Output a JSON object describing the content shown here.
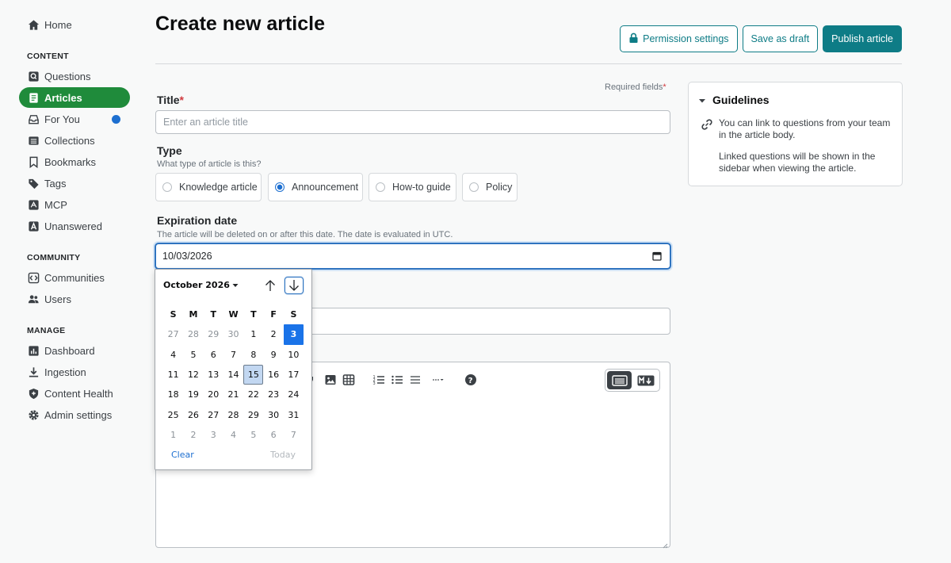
{
  "sidebar": {
    "home": "Home",
    "sections": {
      "content": "CONTENT",
      "community": "COMMUNITY",
      "manage": "MANAGE"
    },
    "content_items": [
      {
        "label": "Questions",
        "icon": "questions-icon"
      },
      {
        "label": "Articles",
        "icon": "articles-icon",
        "active": true
      },
      {
        "label": "For You",
        "icon": "inbox-icon",
        "badge": true
      },
      {
        "label": "Collections",
        "icon": "collections-icon"
      },
      {
        "label": "Bookmarks",
        "icon": "bookmark-icon"
      },
      {
        "label": "Tags",
        "icon": "tag-icon"
      },
      {
        "label": "MCP",
        "icon": "mcp-icon"
      },
      {
        "label": "Unanswered",
        "icon": "unanswered-icon"
      }
    ],
    "community_items": [
      {
        "label": "Communities",
        "icon": "communities-icon"
      },
      {
        "label": "Users",
        "icon": "users-icon"
      }
    ],
    "manage_items": [
      {
        "label": "Dashboard",
        "icon": "dashboard-icon"
      },
      {
        "label": "Ingestion",
        "icon": "download-icon"
      },
      {
        "label": "Content Health",
        "icon": "shield-icon"
      },
      {
        "label": "Admin settings",
        "icon": "gear-icon"
      }
    ]
  },
  "header": {
    "title": "Create new article",
    "permission_button": "Permission settings",
    "draft_button": "Save as draft",
    "publish_button": "Publish article"
  },
  "form": {
    "required_note": "Required fields",
    "required_mark": "*",
    "title_label": "Title",
    "title_placeholder": "Enter an article title",
    "type_label": "Type",
    "type_hint": "What type of article is this?",
    "types": [
      {
        "label": "Knowledge article",
        "checked": false
      },
      {
        "label": "Announcement",
        "checked": true
      },
      {
        "label": "How-to guide",
        "checked": false
      },
      {
        "label": "Policy",
        "checked": false
      }
    ],
    "expiration_label": "Expiration date",
    "expiration_hint": "The article will be deleted on or after this date. The date is evaluated in UTC.",
    "expiration_value": "10/03/2026"
  },
  "guidelines": {
    "title": "Guidelines",
    "text1": "You can link to questions from your team in the article body.",
    "text2": "Linked questions will be shown in the sidebar when viewing the article."
  },
  "datepicker": {
    "month": "October 2026",
    "weekdays": [
      "S",
      "M",
      "T",
      "W",
      "T",
      "F",
      "S"
    ],
    "days": [
      [
        "27",
        "28",
        "29",
        "30",
        "1",
        "2",
        "3"
      ],
      [
        "4",
        "5",
        "6",
        "7",
        "8",
        "9",
        "10"
      ],
      [
        "11",
        "12",
        "13",
        "14",
        "15",
        "16",
        "17"
      ],
      [
        "18",
        "19",
        "20",
        "21",
        "22",
        "23",
        "24"
      ],
      [
        "25",
        "26",
        "27",
        "28",
        "29",
        "30",
        "31"
      ],
      [
        "1",
        "2",
        "3",
        "4",
        "5",
        "6",
        "7"
      ]
    ],
    "selected": "3",
    "today": "15",
    "clear": "Clear",
    "today_label": "Today"
  },
  "colors": {
    "accent": "#0e7c86",
    "nav_active": "#1f8b3b",
    "selected_day": "#1a73e8",
    "required": "#d0393e"
  }
}
